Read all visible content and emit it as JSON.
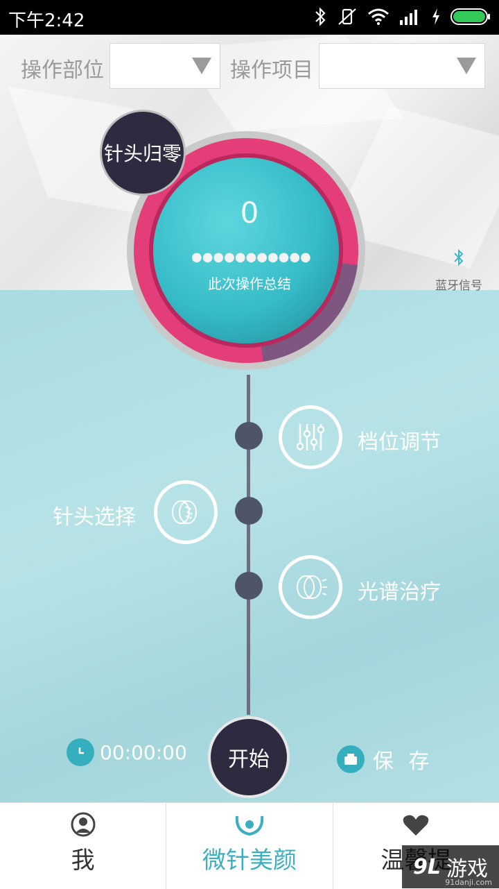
{
  "status_bar": {
    "time": "下午2:42"
  },
  "selectors": {
    "part_label": "操作部位",
    "item_label": "操作项目"
  },
  "needle_zero": {
    "label": "针头归零"
  },
  "gauge": {
    "counter": "0",
    "dots": "●●●●●●●●●●●",
    "summary_label": "此次操作总结",
    "colors": {
      "ring": "#e33d7a",
      "ring_dim": "#6d5a80",
      "core": "#3cc3cd"
    }
  },
  "bluetooth": {
    "label": "蓝牙信号"
  },
  "steps": {
    "gear": {
      "label": "档位调节"
    },
    "needle": {
      "label": "针头选择"
    },
    "spectrum": {
      "label": "光谱治疗"
    }
  },
  "timer": {
    "value": "00:00:00"
  },
  "start": {
    "label": "开始"
  },
  "save": {
    "label": "保 存"
  },
  "tabs": [
    {
      "label": "我",
      "icon": "user-icon"
    },
    {
      "label": "微针美颜",
      "icon": "face-icon"
    },
    {
      "label": "温馨提",
      "icon": "heart-icon"
    }
  ],
  "watermark": {
    "brand": "游戏",
    "logo_text": "9L",
    "site": "91danji.com"
  }
}
